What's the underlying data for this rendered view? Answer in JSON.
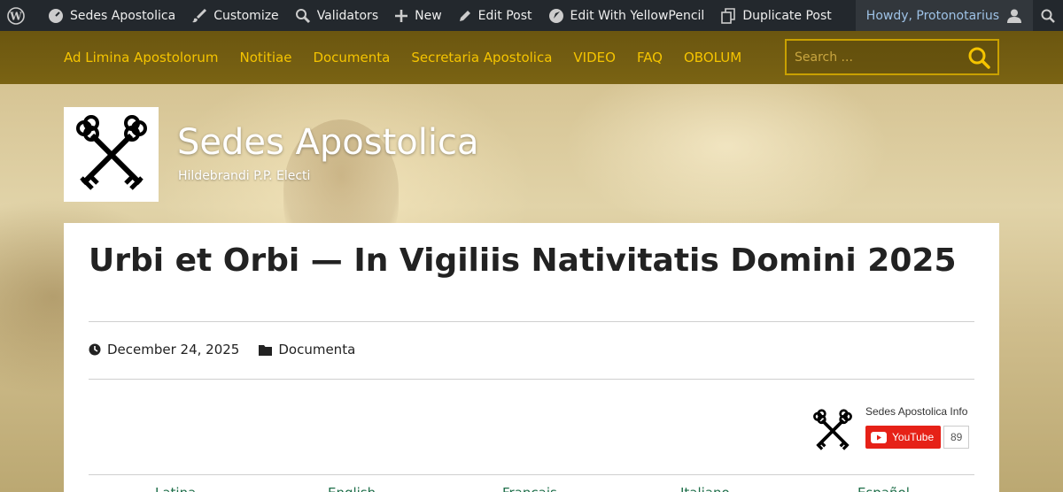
{
  "adminbar": {
    "items": [
      {
        "label": "Sedes Apostolica"
      },
      {
        "label": "Customize"
      },
      {
        "label": "Validators"
      },
      {
        "label": "New"
      },
      {
        "label": "Edit Post"
      },
      {
        "label": "Edit With YellowPencil"
      },
      {
        "label": "Duplicate Post"
      }
    ],
    "howdy": "Howdy, Protonotarius"
  },
  "nav": {
    "items": [
      "Ad Limina Apostolorum",
      "Notitiae",
      "Documenta",
      "Secretaria Apostolica",
      "VIDEO",
      "FAQ",
      "OBOLUM"
    ],
    "search_placeholder": "Search ..."
  },
  "site": {
    "title": "Sedes Apostolica",
    "tagline": "Hildebrandi P.P. Electi"
  },
  "post": {
    "title": "Urbi et Orbi — In Vigiliis Nativitatis Domini 2025",
    "date": "December 24, 2025",
    "category": "Documenta"
  },
  "youtube": {
    "channel": "Sedes Apostolica Info",
    "button": "YouTube",
    "count": "89"
  },
  "languages": [
    "Latina",
    "English",
    "Français",
    "Italiano",
    "Español"
  ],
  "colors": {
    "admin_bg": "#23282d",
    "nav_bg": "#6b5610",
    "nav_text": "#f5c400",
    "youtube_red": "#e62117"
  }
}
